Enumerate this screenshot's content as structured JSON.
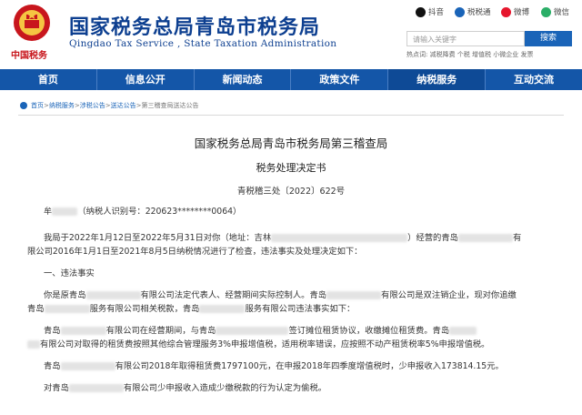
{
  "colors": {
    "brand_blue": "#0d3f90",
    "nav_blue": "#1456a8",
    "accent_red": "#c8161d"
  },
  "header": {
    "title_cn": "国家税务总局青岛市税务局",
    "title_en": "Qingdao Tax Service , State Taxation Administration",
    "tax_logo_text": "中国税务"
  },
  "social": [
    {
      "label": "抖音",
      "icon": "douyin-icon",
      "color": "#111111"
    },
    {
      "label": "税税通",
      "icon": "shuishuitong-icon",
      "color": "#1a64b8"
    },
    {
      "label": "微博",
      "icon": "weibo-icon",
      "color": "#e6162d"
    },
    {
      "label": "微信",
      "icon": "wechat-icon",
      "color": "#2aae67"
    }
  ],
  "search": {
    "placeholder": "请输入关键字",
    "button": "搜索",
    "hotwords": "热点词: 减税降费    个税    增值税    小微企业    发票"
  },
  "nav": [
    "首页",
    "信息公开",
    "新闻动态",
    "政策文件",
    "纳税服务",
    "互动交流"
  ],
  "nav_active": "纳税服务",
  "breadcrumb": {
    "home": "首页",
    "items": [
      "纳税服务",
      "涉税公告",
      "送达公告",
      "第三稽查局送达公告"
    ],
    "sep": " > "
  },
  "article": {
    "title": "国家税务总局青岛市税务局第三稽查局",
    "subtitle": "税务处理决定书",
    "doc_no": "青税稽三处〔2022〕622号",
    "recipient_prefix": "牟",
    "recipient_suffix": "（纳税人识别号：220623********0064）",
    "intro_line1_a": "我局于2022年1月12日至2022年5月31日对你（地址：吉林",
    "intro_line1_b": "）经营的青岛",
    "intro_line1_c": "有",
    "intro_line2": "限公司2016年1月1日至2021年8月5日纳税情况进行了检查，违法事实及处理决定如下：",
    "section1": "一、违法事实",
    "p1_line1_a": "你是原青岛",
    "p1_line1_b": "有限公司法定代表人、经营期间实际控制人。青岛",
    "p1_line1_c": "有限公司是双注销企业，现对你追缴",
    "p1_line2_a": "青岛",
    "p1_line2_b": "服务有限公司相关税款，青岛",
    "p1_line2_c": "服务有限公司违法事实如下：",
    "p2_line1_a": "青岛",
    "p2_line1_b": "有限公司在经营期间，与青岛",
    "p2_line1_c": "签订摊位租赁协议，收缴摊位租赁费。青岛",
    "p2_line2": "有限公司对取得的租赁费按照其他综合管理服务3%申报增值税，适用税率错误，应按照不动产租赁税率5%申报增值税。",
    "p3_a": "青岛",
    "p3_b": "有限公司2018年取得租赁费1797100元，在申报2018年四季度增值税时，少申报收入173814.15元。",
    "p4_a": "对青岛",
    "p4_b": "有限公司少申报收入造成少缴税款的行为认定为偷税。"
  }
}
